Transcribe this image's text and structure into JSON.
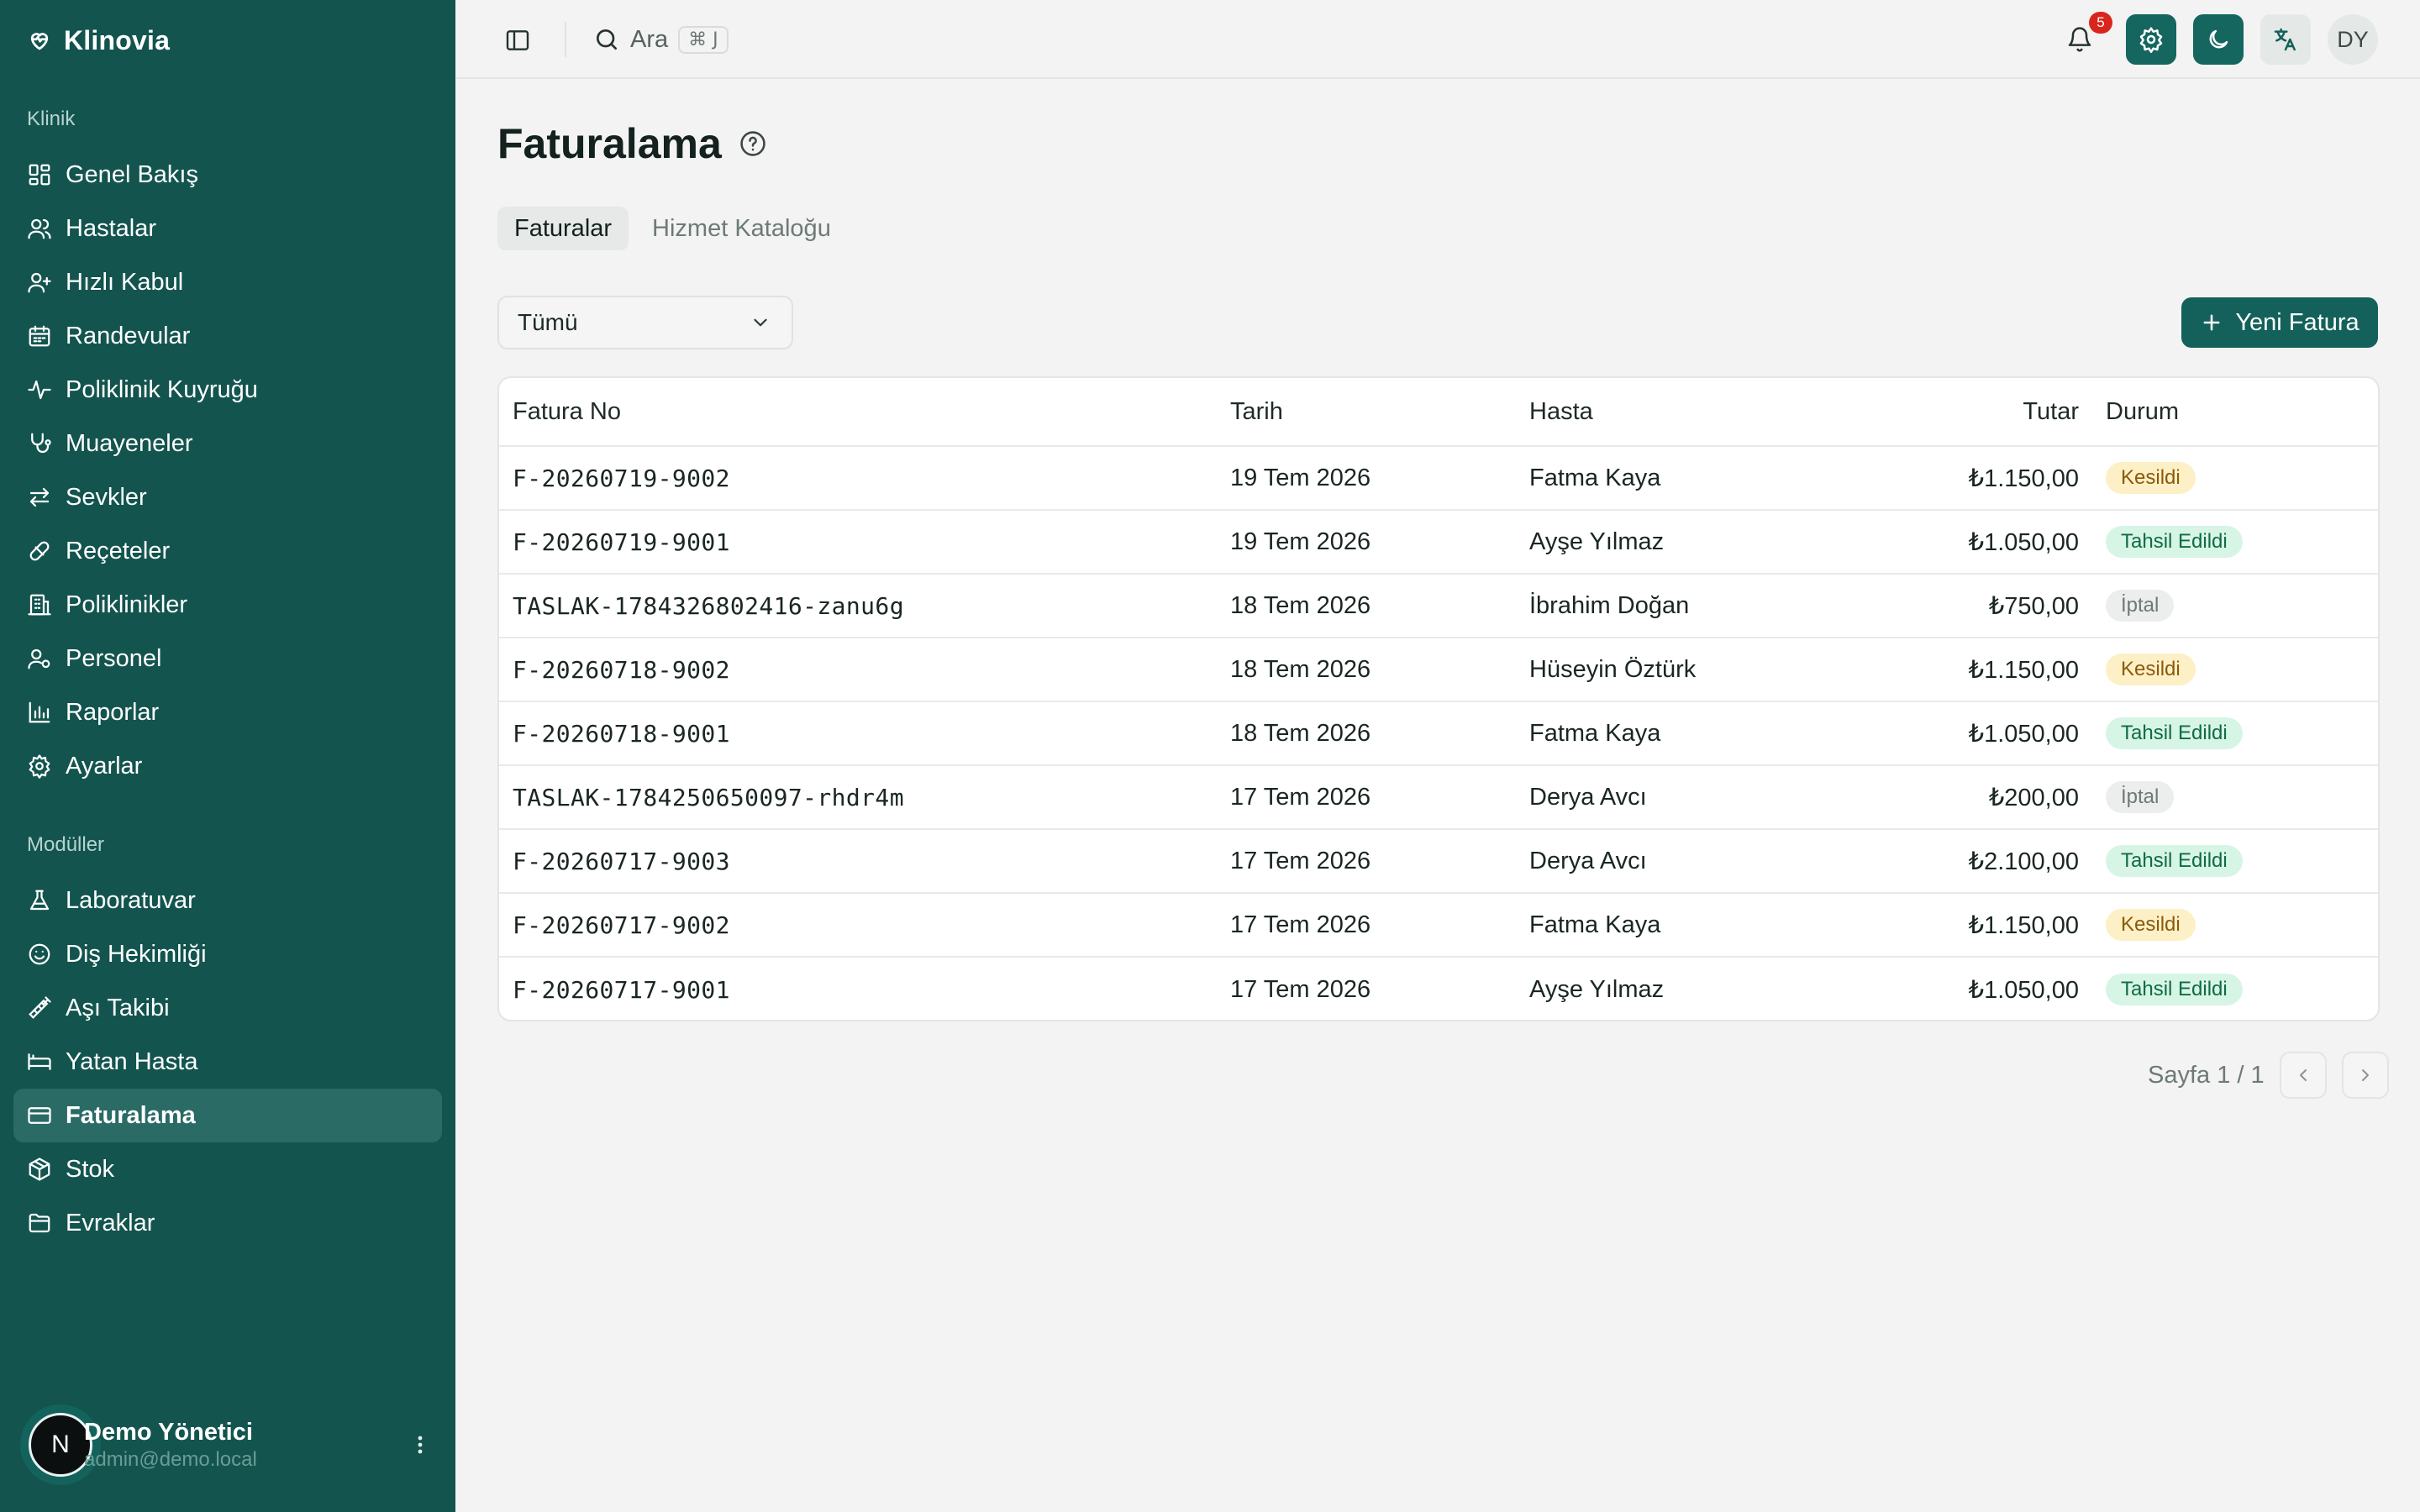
{
  "app": {
    "name": "Klinovia"
  },
  "sidebar": {
    "group_clinic": "Klinik",
    "clinic_items": [
      {
        "label": "Genel Bakış",
        "icon": "dashboard-icon"
      },
      {
        "label": "Hastalar",
        "icon": "users-icon"
      },
      {
        "label": "Hızlı Kabul",
        "icon": "user-plus-icon"
      },
      {
        "label": "Randevular",
        "icon": "calendar-icon"
      },
      {
        "label": "Poliklinik Kuyruğu",
        "icon": "activity-icon"
      },
      {
        "label": "Muayeneler",
        "icon": "stethoscope-icon"
      },
      {
        "label": "Sevkler",
        "icon": "arrows-icon"
      },
      {
        "label": "Reçeteler",
        "icon": "pill-icon"
      },
      {
        "label": "Poliklinikler",
        "icon": "building-icon"
      },
      {
        "label": "Personel",
        "icon": "staff-icon"
      },
      {
        "label": "Raporlar",
        "icon": "chart-icon"
      },
      {
        "label": "Ayarlar",
        "icon": "gear-icon"
      }
    ],
    "group_modules": "Modüller",
    "module_items": [
      {
        "label": "Laboratuvar",
        "icon": "flask-icon"
      },
      {
        "label": "Diş Hekimliği",
        "icon": "smile-icon"
      },
      {
        "label": "Aşı Takibi",
        "icon": "syringe-icon"
      },
      {
        "label": "Yatan Hasta",
        "icon": "bed-icon"
      },
      {
        "label": "Faturalama",
        "icon": "credit-card-icon",
        "active": true
      },
      {
        "label": "Stok",
        "icon": "package-icon"
      },
      {
        "label": "Evraklar",
        "icon": "folder-icon"
      }
    ],
    "user": {
      "initial": "N",
      "name": "Demo Yönetici",
      "email": "admin@demo.local"
    }
  },
  "header": {
    "search_label": "Ara",
    "search_shortcut": "⌘ J",
    "notification_count": "5",
    "user_initials": "DY"
  },
  "page": {
    "title": "Faturalama",
    "tabs": [
      "Faturalar",
      "Hizmet Kataloğu"
    ],
    "active_tab": "Faturalar",
    "filter_value": "Tümü",
    "new_button": "Yeni Fatura"
  },
  "table": {
    "headers": {
      "no": "Fatura No",
      "date": "Tarih",
      "patient": "Hasta",
      "amount": "Tutar",
      "status": "Durum"
    },
    "rows": [
      {
        "no": "F-20260719-9002",
        "date": "19 Tem 2026",
        "patient": "Fatma Kaya",
        "amount": "₺1.150,00",
        "status": "Kesildi",
        "status_kind": "kesildi"
      },
      {
        "no": "F-20260719-9001",
        "date": "19 Tem 2026",
        "patient": "Ayşe Yılmaz",
        "amount": "₺1.050,00",
        "status": "Tahsil Edildi",
        "status_kind": "tahsil"
      },
      {
        "no": "TASLAK-1784326802416-zanu6g",
        "date": "18 Tem 2026",
        "patient": "İbrahim Doğan",
        "amount": "₺750,00",
        "status": "İptal",
        "status_kind": "iptal"
      },
      {
        "no": "F-20260718-9002",
        "date": "18 Tem 2026",
        "patient": "Hüseyin Öztürk",
        "amount": "₺1.150,00",
        "status": "Kesildi",
        "status_kind": "kesildi"
      },
      {
        "no": "F-20260718-9001",
        "date": "18 Tem 2026",
        "patient": "Fatma Kaya",
        "amount": "₺1.050,00",
        "status": "Tahsil Edildi",
        "status_kind": "tahsil"
      },
      {
        "no": "TASLAK-1784250650097-rhdr4m",
        "date": "17 Tem 2026",
        "patient": "Derya Avcı",
        "amount": "₺200,00",
        "status": "İptal",
        "status_kind": "iptal"
      },
      {
        "no": "F-20260717-9003",
        "date": "17 Tem 2026",
        "patient": "Derya Avcı",
        "amount": "₺2.100,00",
        "status": "Tahsil Edildi",
        "status_kind": "tahsil"
      },
      {
        "no": "F-20260717-9002",
        "date": "17 Tem 2026",
        "patient": "Fatma Kaya",
        "amount": "₺1.150,00",
        "status": "Kesildi",
        "status_kind": "kesildi"
      },
      {
        "no": "F-20260717-9001",
        "date": "17 Tem 2026",
        "patient": "Ayşe Yılmaz",
        "amount": "₺1.050,00",
        "status": "Tahsil Edildi",
        "status_kind": "tahsil"
      }
    ]
  },
  "pagination": {
    "label": "Sayfa 1 / 1"
  },
  "colors": {
    "sidebar_bg": "#13544f",
    "accent": "#13615a",
    "danger": "#d9261c"
  }
}
